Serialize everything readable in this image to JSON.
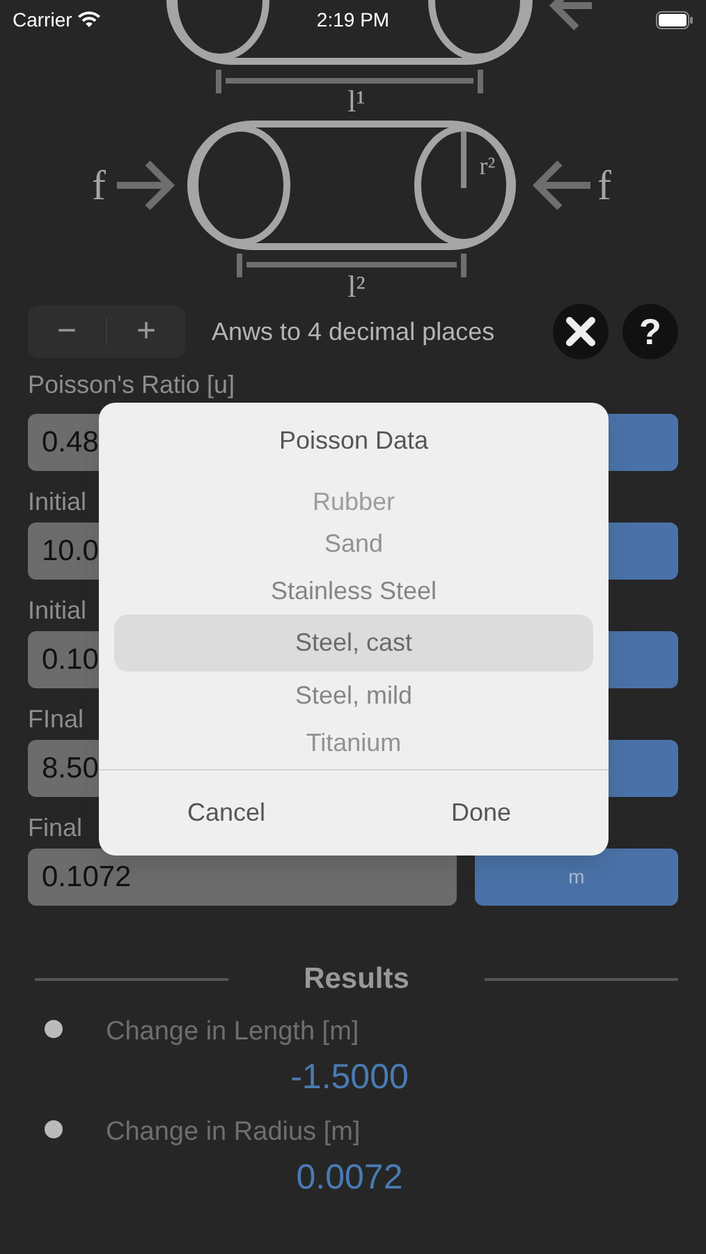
{
  "status_bar": {
    "carrier": "Carrier",
    "time": "2:19 PM"
  },
  "diagram": {
    "top_length_label": "l¹",
    "force_left": "f",
    "force_right": "f",
    "radius_label": "r²",
    "length_label": "l²"
  },
  "precision": {
    "minus": "−",
    "plus": "+",
    "text": "Anws to 4 decimal places",
    "help": "?"
  },
  "fields": [
    {
      "label": "Poisson's Ratio [u]",
      "value": "0.48"
    },
    {
      "label": "Initial",
      "value": "10.0"
    },
    {
      "label": "Initial",
      "value": "0.10"
    },
    {
      "label": "FInal",
      "value": "8.50"
    },
    {
      "label": "Final",
      "value": "0.1072",
      "unit": "m"
    }
  ],
  "results": {
    "title": "Results",
    "items": [
      {
        "label": "Change in Length [m]",
        "value": "-1.5000"
      },
      {
        "label": "Change in Radius [m]",
        "value": "0.0072"
      }
    ]
  },
  "dialog": {
    "title": "Poisson Data",
    "options": [
      {
        "label": "Rubber",
        "selected": false
      },
      {
        "label": "Sand",
        "selected": false
      },
      {
        "label": "Stainless Steel",
        "selected": false
      },
      {
        "label": "Steel, cast",
        "selected": true
      },
      {
        "label": "Steel, mild",
        "selected": false
      },
      {
        "label": "Titanium",
        "selected": false
      }
    ],
    "buttons": [
      "Cancel",
      "Done"
    ]
  }
}
